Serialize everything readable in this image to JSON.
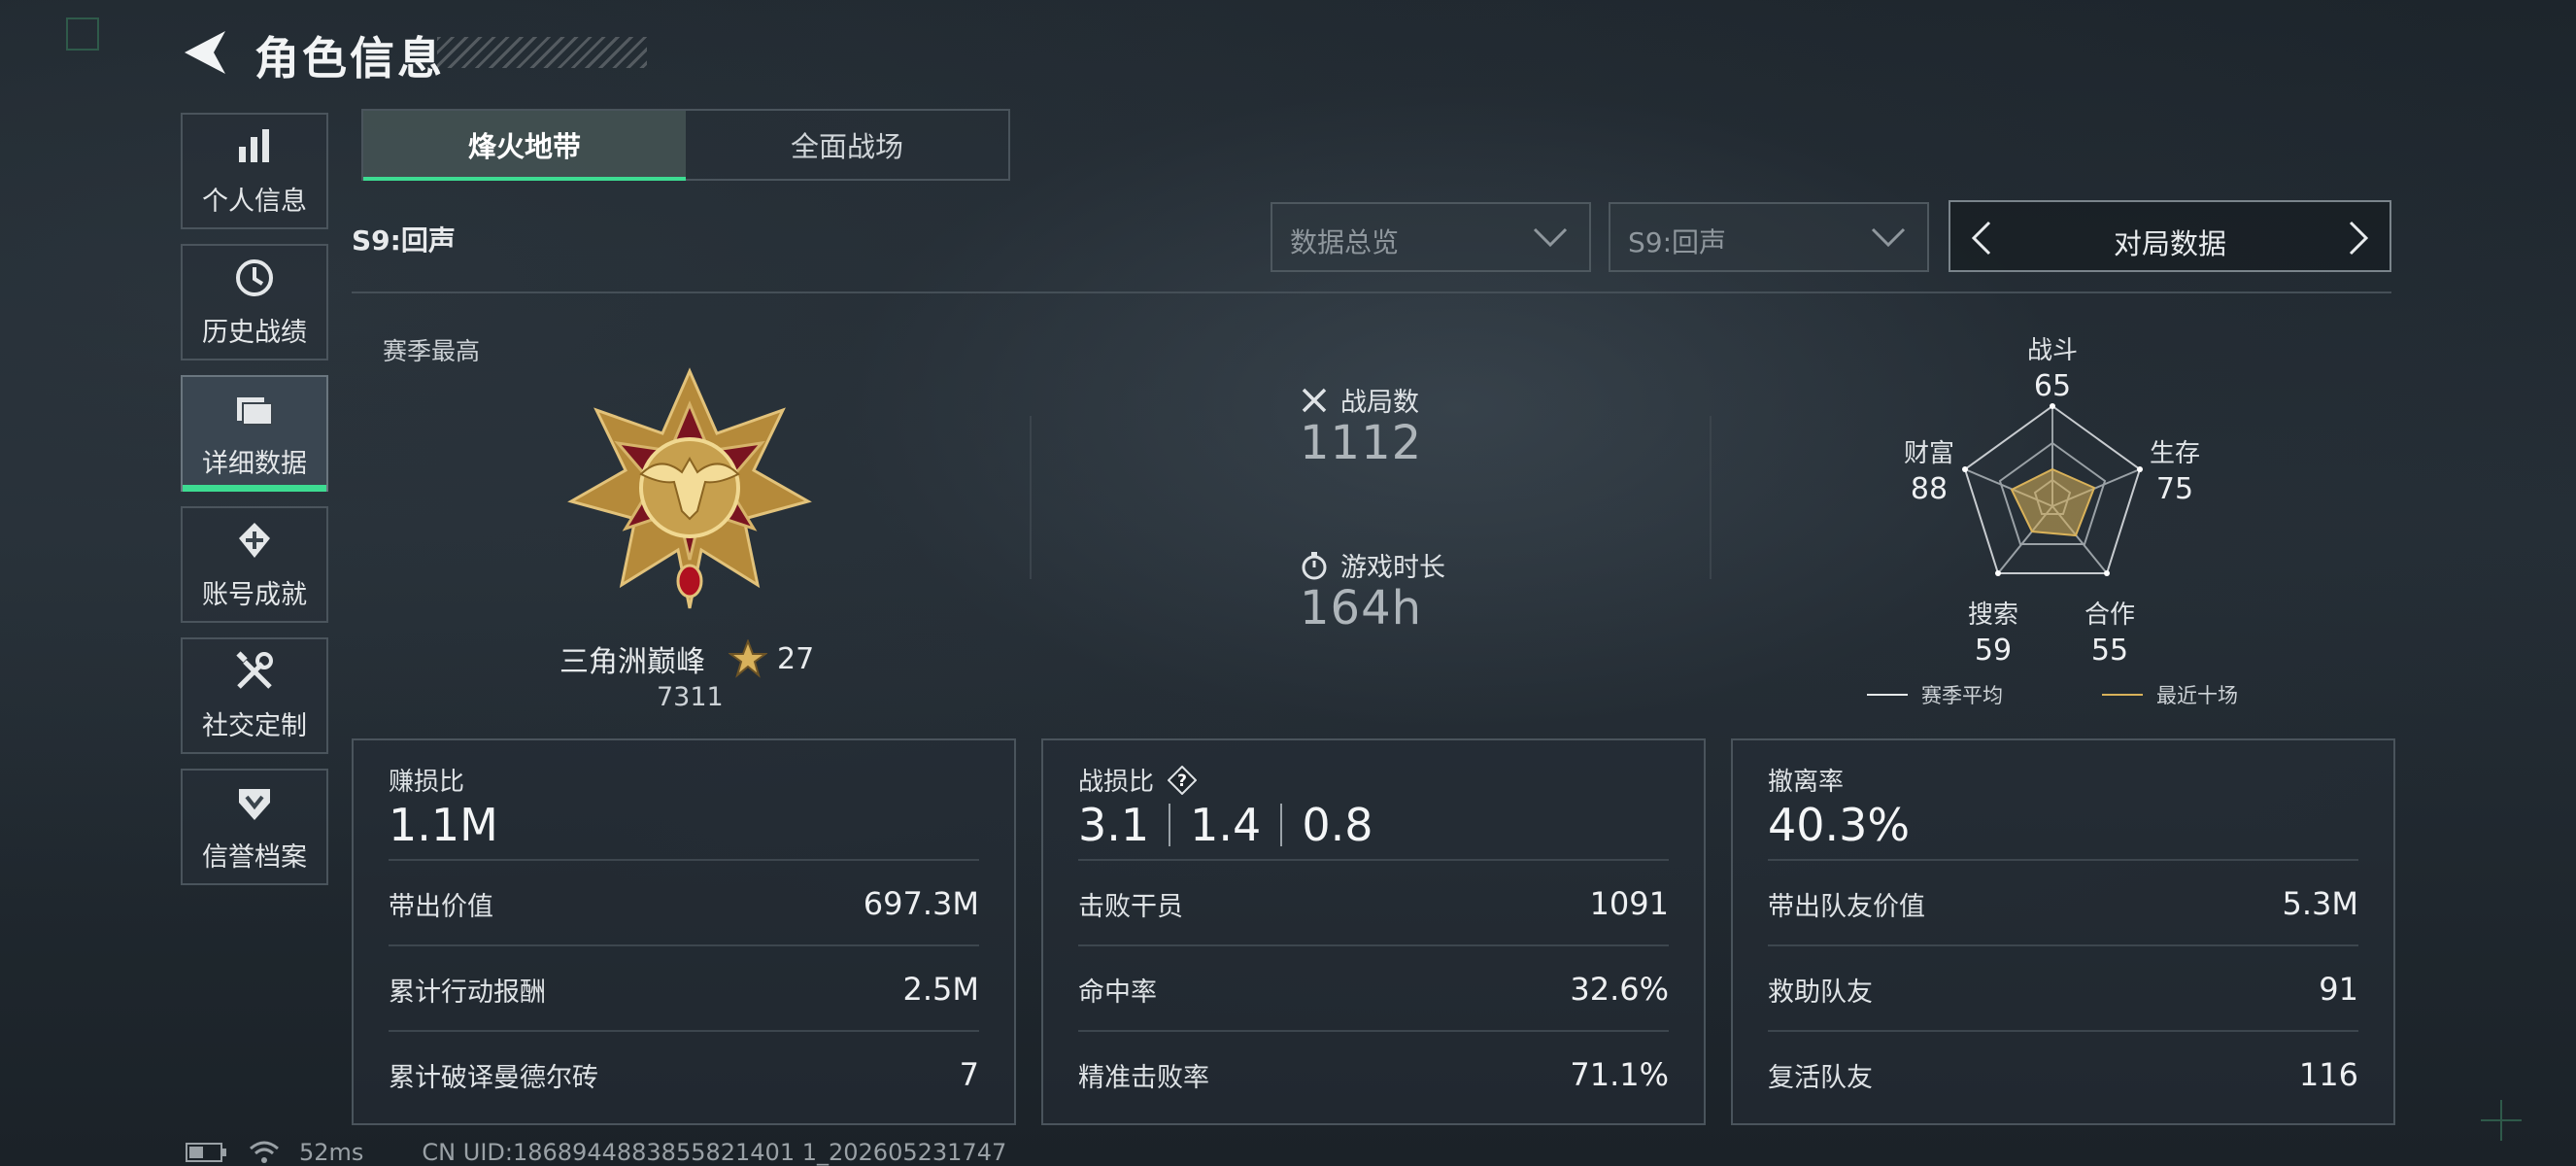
{
  "header": {
    "title": "角色信息"
  },
  "sidebar": {
    "items": [
      {
        "label": "个人信息"
      },
      {
        "label": "历史战绩"
      },
      {
        "label": "详细数据"
      },
      {
        "label": "账号成就"
      },
      {
        "label": "社交定制"
      },
      {
        "label": "信誉档案"
      }
    ],
    "active_index": 2
  },
  "mode_tabs": [
    {
      "label": "烽火地带"
    },
    {
      "label": "全面战场"
    }
  ],
  "active_mode": 0,
  "season_label": "S9:回声",
  "filters": {
    "data_dropdown": "数据总览",
    "season_dropdown": "S9:回声",
    "pager_label": "对局数据"
  },
  "overview": {
    "season_best_label": "赛季最高",
    "rank_name": "三角洲巅峰",
    "rank_stars": "27",
    "rank_score": "7311",
    "matches_label": "战局数",
    "matches_value": "1112",
    "playtime_label": "游戏时长",
    "playtime_value": "164h"
  },
  "radar": {
    "axes": [
      {
        "label": "战斗",
        "value": "65"
      },
      {
        "label": "生存",
        "value": "75"
      },
      {
        "label": "合作",
        "value": "55"
      },
      {
        "label": "搜索",
        "value": "59"
      },
      {
        "label": "财富",
        "value": "88"
      }
    ],
    "legend_season_avg": "赛季平均",
    "legend_recent": "最近十场",
    "colors": {
      "season_avg": "#e6e8ea",
      "recent": "#d9b25a"
    }
  },
  "panels": {
    "profit": {
      "title": "赚损比",
      "big": "1.1M",
      "rows": [
        {
          "k": "带出价值",
          "v": "697.3M"
        },
        {
          "k": "累计行动报酬",
          "v": "2.5M"
        },
        {
          "k": "累计破译曼德尔砖",
          "v": "7"
        }
      ]
    },
    "combat": {
      "title": "战损比",
      "big": [
        "3.1",
        "1.4",
        "0.8"
      ],
      "rows": [
        {
          "k": "击败干员",
          "v": "1091"
        },
        {
          "k": "命中率",
          "v": "32.6%"
        },
        {
          "k": "精准击败率",
          "v": "71.1%"
        }
      ]
    },
    "extract": {
      "title": "撤离率",
      "big": "40.3%",
      "rows": [
        {
          "k": "带出队友价值",
          "v": "5.3M"
        },
        {
          "k": "救助队友",
          "v": "91"
        },
        {
          "k": "复活队友",
          "v": "116"
        }
      ]
    }
  },
  "status_bar": {
    "ping": "52ms",
    "uid": "CN UID:1868944883855821401 1_202605231747"
  },
  "colors": {
    "accent": "#3ddc92"
  }
}
